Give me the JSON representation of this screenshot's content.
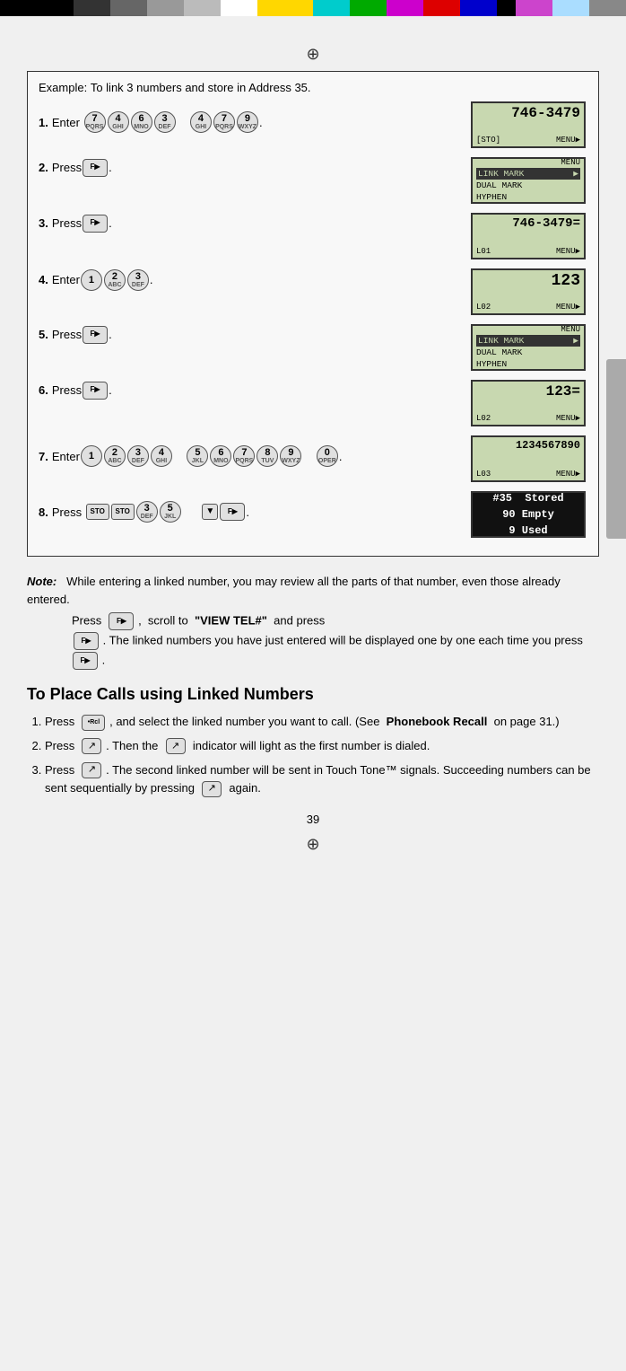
{
  "colors": {
    "lcd_bg": "#c8d8b0",
    "key_bg": "#e0e0e0"
  },
  "colorbar": {
    "segments": [
      "black",
      "dark",
      "mid",
      "light",
      "lighter",
      "white",
      "yellow",
      "cyan",
      "green",
      "magenta",
      "red",
      "blue",
      "navy",
      "purple",
      "pink",
      "ltblue",
      "gray2"
    ]
  },
  "example": {
    "title": "Example:",
    "subtitle": "To link 3 numbers and store in Address 35.",
    "steps": [
      {
        "num": "1.",
        "label": "Enter",
        "keys": [
          "7PQRS",
          "4GHI",
          "6MNO",
          "3DEF",
          "4GHI",
          "7PQRS",
          "9WXYZ"
        ],
        "screen_type": "number",
        "screen_line1": "746-3479",
        "screen_line2": "[STO]",
        "screen_line3": "MENU▶"
      },
      {
        "num": "2.",
        "label": "Press",
        "keys": [
          "F▶"
        ],
        "screen_type": "menu",
        "menu_top": "MENU",
        "menu_items": [
          "LINK MARK ▶",
          "DUAL MARK",
          "HYPHEN"
        ]
      },
      {
        "num": "3.",
        "label": "Press",
        "keys": [
          "F▶"
        ],
        "screen_type": "number",
        "screen_line1": "746-3479=",
        "screen_line2": "L01",
        "screen_line3": "MENU▶"
      },
      {
        "num": "4.",
        "label": "Enter",
        "keys": [
          "1",
          "2ABC",
          "3DEF"
        ],
        "screen_type": "number",
        "screen_line1": "123",
        "screen_line2": "L02",
        "screen_line3": "MENU▶"
      },
      {
        "num": "5.",
        "label": "Press",
        "keys": [
          "F▶"
        ],
        "screen_type": "menu",
        "menu_top": "MENU",
        "menu_items": [
          "LINK MARK ▶",
          "DUAL MARK",
          "HYPHEN"
        ]
      },
      {
        "num": "6.",
        "label": "Press",
        "keys": [
          "F▶"
        ],
        "screen_type": "number",
        "screen_line1": "123=",
        "screen_line2": "L02",
        "screen_line3": "MENU▶"
      },
      {
        "num": "7.",
        "label": "Enter",
        "keys": [
          "1",
          "2ABC",
          "3DEF",
          "4GHI",
          "5JKL",
          "6MNO",
          "7PQRS",
          "8TUV",
          "9WXYZ",
          "0OPER"
        ],
        "screen_type": "number",
        "screen_line1": "1234567890",
        "screen_line2": "L03",
        "screen_line3": "MENU▶"
      },
      {
        "num": "8.",
        "label": "Press",
        "keys": [
          "STO",
          "STO",
          "3DEF",
          "5JKL",
          "▼",
          "F▶"
        ],
        "screen_type": "stored",
        "stored_lines": [
          "#35  Stored",
          "90 Empty",
          "9 Used"
        ]
      }
    ]
  },
  "note": {
    "label": "Note:",
    "text1": "While entering a linked number, you may review all the parts of that number, even those already entered.",
    "text2": "Press",
    "text3": ", scroll to",
    "text4": "\"VIEW TEL#\"",
    "text5": "and press",
    "text6": ". The linked numbers you have just entered will be displayed one by one each time you press",
    "text7": "."
  },
  "section_heading": "To Place Calls using Linked Numbers",
  "list_items": [
    {
      "num": "1.",
      "text_before": "Press",
      "key": "Rcl",
      "text_after": ", and select the linked number you want to call. (See",
      "bold": "Phonebook Recall",
      "text_end": "on page 31.)"
    },
    {
      "num": "2.",
      "text_before": "Press",
      "key": "↗",
      "text_after": ". Then the",
      "key2": "↗",
      "text_end": "indicator will light as the first number is dialed."
    },
    {
      "num": "3.",
      "text_before": "Press",
      "key": "↗",
      "text_after": ". The second linked number will be sent in Touch Tone™ signals. Succeeding numbers can be sent sequentially by pressing",
      "key2": "↗",
      "text_end": "again."
    }
  ],
  "page_number": "39"
}
